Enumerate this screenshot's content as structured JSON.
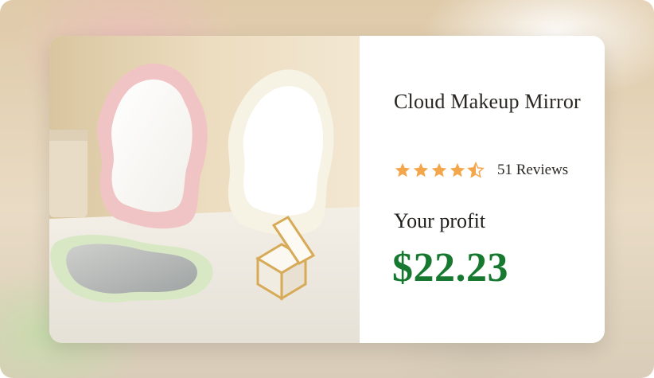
{
  "product": {
    "title": "Cloud Makeup Mirror",
    "rating": 4.5,
    "rating_max": 5,
    "reviews_text": "51 Reviews"
  },
  "profit": {
    "label": "Your profit",
    "value": "$22.23"
  },
  "colors": {
    "star": "#f4a64a",
    "profit": "#17792f",
    "text": "#2a2723"
  },
  "icons": {
    "star": "star-icon",
    "half_star": "star-half-icon"
  }
}
